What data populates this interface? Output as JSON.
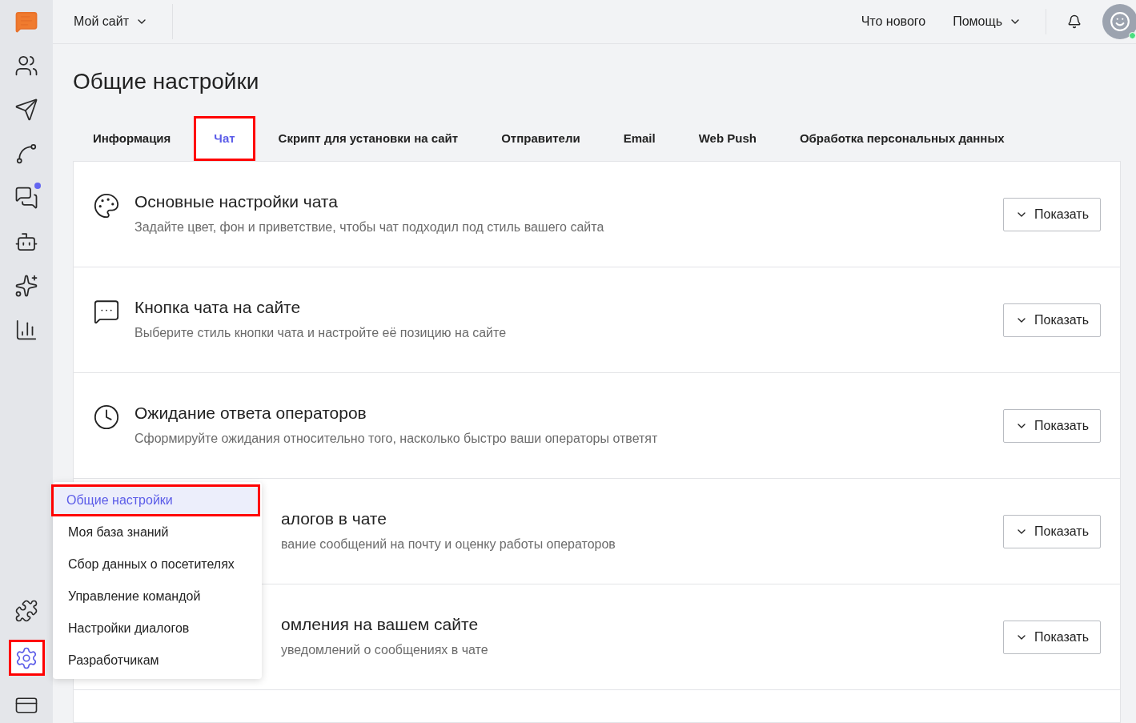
{
  "sidebar": {
    "top_icons": [
      {
        "kind": "logo"
      },
      {
        "kind": "people"
      },
      {
        "kind": "send"
      },
      {
        "kind": "route"
      },
      {
        "kind": "chats",
        "badge": true
      },
      {
        "kind": "bot"
      },
      {
        "kind": "sparkle"
      },
      {
        "kind": "report"
      }
    ],
    "bottom_icons": [
      {
        "kind": "puzzle",
        "selected": false,
        "annotated": false
      },
      {
        "kind": "settings",
        "selected": true,
        "annotated": true
      },
      {
        "kind": "billing",
        "selected": false,
        "annotated": false
      }
    ]
  },
  "topbar": {
    "site": "Мой сайт",
    "whats_new": "Что нового",
    "help": "Помощь",
    "avatar_online": true
  },
  "page_title": "Общие настройки",
  "tabs": [
    {
      "label": "Информация",
      "selected": false,
      "annotated": false
    },
    {
      "label": "Чат",
      "selected": true,
      "annotated": true
    },
    {
      "label": "Скрипт для установки на сайт",
      "selected": false,
      "annotated": false
    },
    {
      "label": "Отправители",
      "selected": false,
      "annotated": false
    },
    {
      "label": "Email",
      "selected": false,
      "annotated": false
    },
    {
      "label": "Web Push",
      "selected": false,
      "annotated": false
    },
    {
      "label": "Обработка персональных данных",
      "selected": false,
      "annotated": false
    }
  ],
  "sections": [
    {
      "kind": "palette",
      "title": "Основные настройки чата",
      "description": "Задайте цвет, фон и приветствие, чтобы чат подходил под стиль вашего сайта",
      "button": "Показать"
    },
    {
      "kind": "chat",
      "title": "Кнопка чата на сайте",
      "description": "Выберите стиль кнопки чата и настройте её позицию на сайте",
      "button": "Показать"
    },
    {
      "kind": "clock",
      "title": "Ожидание ответа операторов",
      "description": "Сформируйте ожидания относительно того, насколько быстро ваши операторы ответят",
      "button": "Показать"
    },
    {
      "kind": "covered",
      "title": "алогов в чате",
      "description": "вание сообщений на почту и оценку работы операторов",
      "button": "Показать"
    },
    {
      "kind": "covered",
      "title": "омления на вашем сайте",
      "description": "уведомлений о сообщениях в чате",
      "button": "Показать"
    },
    {
      "kind": "empty"
    }
  ],
  "menu": [
    {
      "label": "Общие настройки",
      "selected": true,
      "annotated": true
    },
    {
      "label": "Моя база знаний",
      "selected": false,
      "annotated": false
    },
    {
      "label": "Сбор данных о посетителях",
      "selected": false,
      "annotated": false
    },
    {
      "label": "Управление командой",
      "selected": false,
      "annotated": false
    },
    {
      "label": "Настройки диалогов",
      "selected": false,
      "annotated": false
    },
    {
      "label": "Разработчикам",
      "selected": false,
      "annotated": false
    }
  ]
}
